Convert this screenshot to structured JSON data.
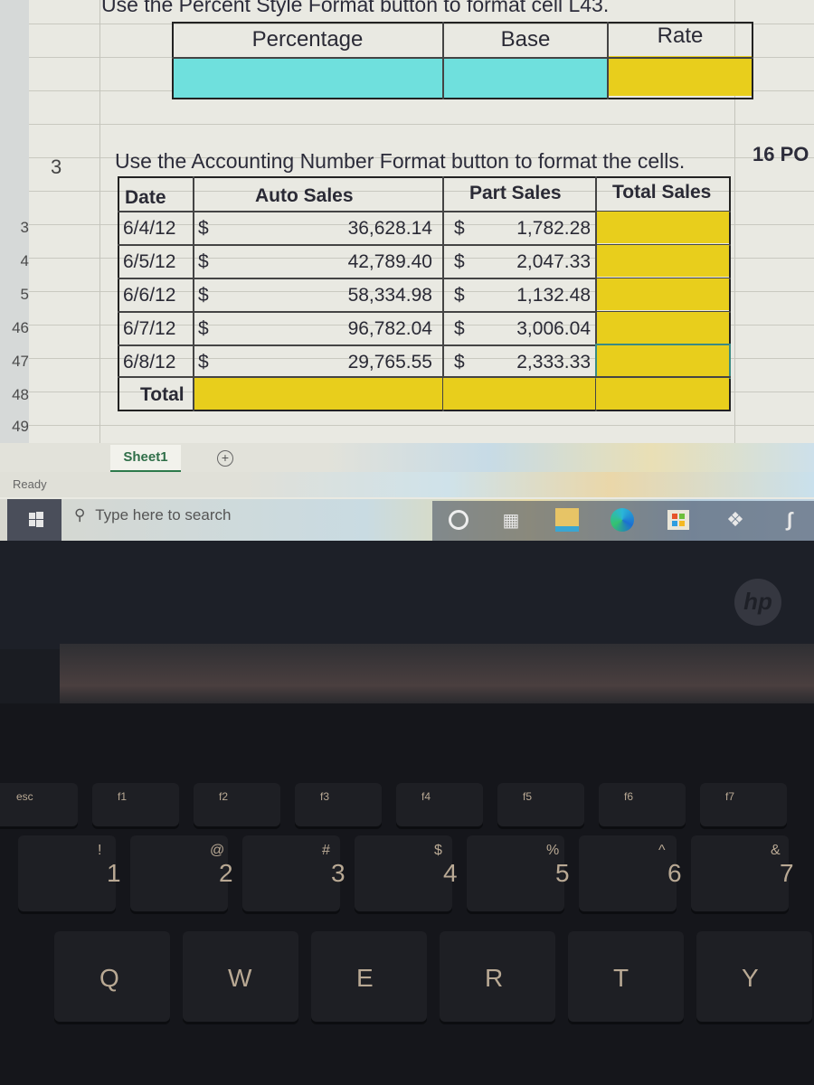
{
  "spreadsheet": {
    "instruction_percent": "Use the Percent Style Format button to format cell L43.",
    "percent_table": {
      "headers": [
        "Percentage",
        "Base",
        "Rate"
      ],
      "row_colors": [
        "#6fe0dd",
        "#6fe0dd",
        "#e8ce1c"
      ]
    },
    "step_number": "3",
    "instruction_accounting": "Use the Accounting Number Format button to format the cells.",
    "points_label": "16 PO",
    "sales_table": {
      "headers": [
        "Date",
        "Auto Sales",
        "Part Sales",
        "Total Sales"
      ],
      "currency_symbol": "$",
      "rows": [
        {
          "row": "3",
          "date": "6/4/12",
          "auto": "36,628.14",
          "part": "1,782.28",
          "total": ""
        },
        {
          "row": "4",
          "date": "6/5/12",
          "auto": "42,789.40",
          "part": "2,047.33",
          "total": ""
        },
        {
          "row": "5",
          "date": "6/6/12",
          "auto": "58,334.98",
          "part": "1,132.48",
          "total": ""
        },
        {
          "row": "46",
          "date": "6/7/12",
          "auto": "96,782.04",
          "part": "3,006.04",
          "total": ""
        },
        {
          "row": "47",
          "date": "6/8/12",
          "auto": "29,765.55",
          "part": "2,333.33",
          "total": ""
        }
      ],
      "total_row": {
        "row": "48",
        "label": "Total"
      },
      "selected_cell_row": 4,
      "highlight_color": "#e8ce1c"
    },
    "extra_row": "49",
    "sheet_tab": "Sheet1",
    "add_sheet": "+",
    "status": "Ready"
  },
  "taskbar": {
    "search_placeholder": "Type here to search",
    "icons": [
      "cortana-icon",
      "task-view-icon",
      "file-explorer-icon",
      "edge-icon",
      "store-icon",
      "dropbox-icon",
      "app-icon"
    ]
  },
  "laptop": {
    "brand": "hp",
    "fn_keys": [
      "esc",
      "f1",
      "f2",
      "f3",
      "f4",
      "f5",
      "f6",
      "f7"
    ],
    "number_keys": [
      {
        "main": "1",
        "sub": "!"
      },
      {
        "main": "2",
        "sub": "@"
      },
      {
        "main": "3",
        "sub": "#"
      },
      {
        "main": "4",
        "sub": "$"
      },
      {
        "main": "5",
        "sub": "%"
      },
      {
        "main": "6",
        "sub": "^"
      },
      {
        "main": "7",
        "sub": "&"
      }
    ],
    "letter_keys": [
      "Q",
      "W",
      "E",
      "R",
      "T",
      "Y"
    ]
  }
}
